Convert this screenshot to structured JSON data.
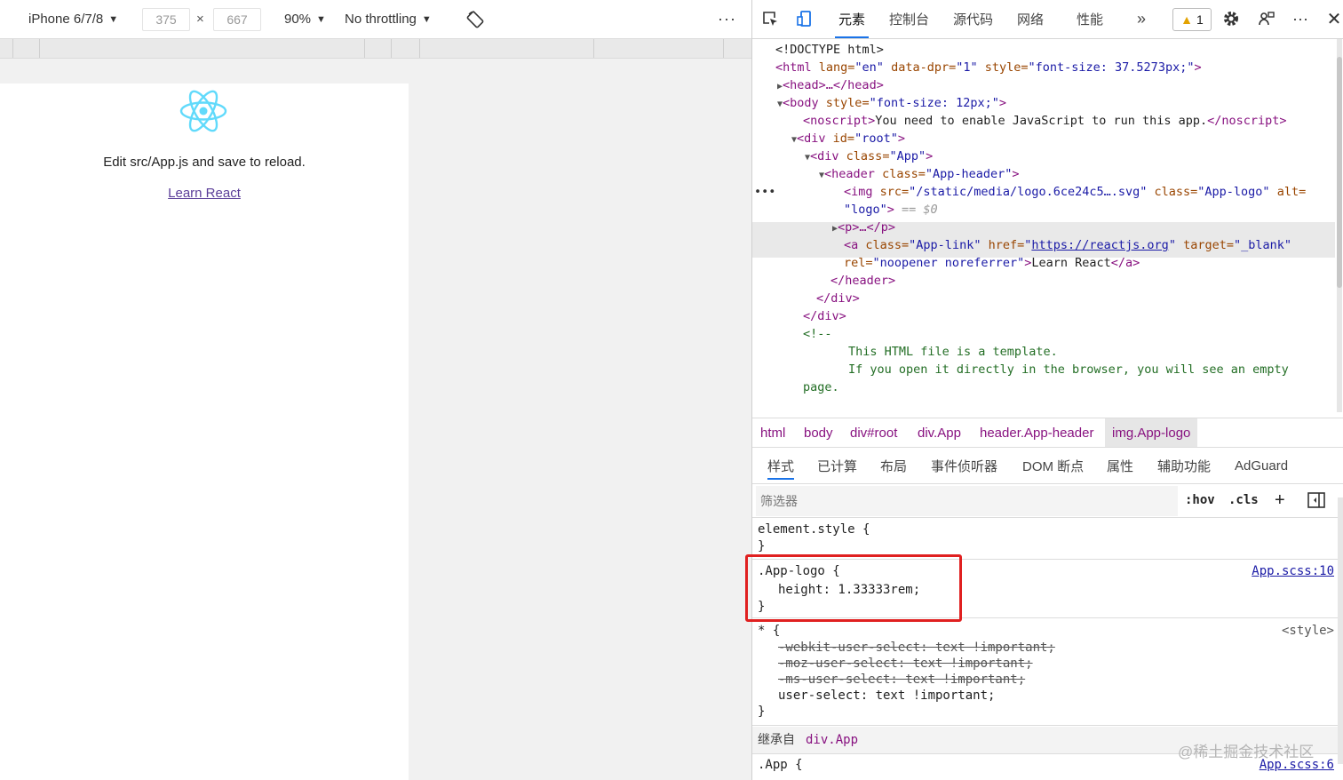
{
  "device_toolbar": {
    "device": "iPhone 6/7/8",
    "width": "375",
    "times": "×",
    "height": "667",
    "zoom": "90%",
    "throttling": "No throttling",
    "more": "⋮"
  },
  "app": {
    "edit_text": "Edit src/App.js and save to reload.",
    "link_text": "Learn React"
  },
  "devtools_tabs": {
    "elements": "元素",
    "console": "控制台",
    "sources": "源代码",
    "network": "网络",
    "performance": "性能",
    "more": "»",
    "warnings": "1"
  },
  "dom": {
    "doctype": "<!DOCTYPE html>",
    "html_open": "<html",
    "lang_attr": " lang=",
    "lang_val": "\"en\"",
    "dpr_attr": " data-dpr=",
    "dpr_val": "\"1\"",
    "style_attr": " style=",
    "html_style_val": "\"font-size: 37.5273px;\"",
    "close_gt": ">",
    "head": "<head>…</head>",
    "body_open": "<body",
    "body_style_val": "\"font-size: 12px;\"",
    "noscript_open": "<noscript>",
    "noscript_text": "You need to enable JavaScript to run this app.",
    "noscript_close": "</noscript>",
    "div_root_open": "<div",
    "id_attr": " id=",
    "root_val": "\"root\"",
    "class_attr": " class=",
    "app_val": "\"App\"",
    "header_open": "<header",
    "header_val": "\"App-header\"",
    "img_open": "<img",
    "src_attr": " src=",
    "img_src_val": "\"/static/media/logo.6ce24c5….svg\"",
    "img_class_val": "\"App-logo\"",
    "alt_attr": " alt=",
    "alt_val": "\"logo\"",
    "eq0": " == $0",
    "p_collapsed": "<p>…</p>",
    "a_open": "<a",
    "a_class_val": "\"App-link\"",
    "href_attr": " href=",
    "href_val": "https://reactjs.org",
    "target_attr": " target=",
    "target_val": "\"_blank\"",
    "rel_attr": "rel=",
    "rel_val": "\"noopener noreferrer\"",
    "a_text": "Learn React",
    "a_close": "</a>",
    "header_close": "</header>",
    "div_close": "</div>",
    "comment_open": "<!--",
    "comment_line1": "This HTML file is a template.",
    "comment_line2": "If you open it directly in the browser, you will see an empty",
    "comment_line3": "page.",
    "ellipsis": "•••"
  },
  "breadcrumbs": [
    "html",
    "body",
    "div#root",
    "div.App",
    "header.App-header",
    "img.App-logo"
  ],
  "style_tabs": [
    "样式",
    "已计算",
    "布局",
    "事件侦听器",
    "DOM 断点",
    "属性",
    "辅助功能",
    "AdGuard"
  ],
  "filter": {
    "placeholder": "筛选器",
    "hov": ":hov",
    "cls": ".cls",
    "add": "+"
  },
  "styles": {
    "element_style": "element.style {",
    "close_brace": "}",
    "app_logo_selector": ".App-logo {",
    "app_logo_prop": "height",
    "app_logo_value": ": 1.33333rem;",
    "app_logo_source": "App.scss:10",
    "star_selector": "* {",
    "star_source": "<style>",
    "star_props": [
      "-webkit-user-select: text !important;",
      "-moz-user-select: text !important;",
      "-ms-user-select: text !important;"
    ],
    "star_active_prop": "user-select: text !important;",
    "inherited_label": "继承自",
    "inherited_from": "div.App",
    "app_selector": ".App {",
    "app_source": "App.scss:6"
  },
  "watermark": "@稀土掘金技术社区",
  "colors": {
    "react": "#61dafb",
    "highlight": "#e02020",
    "active_tab_underline": "#1a73e8"
  }
}
